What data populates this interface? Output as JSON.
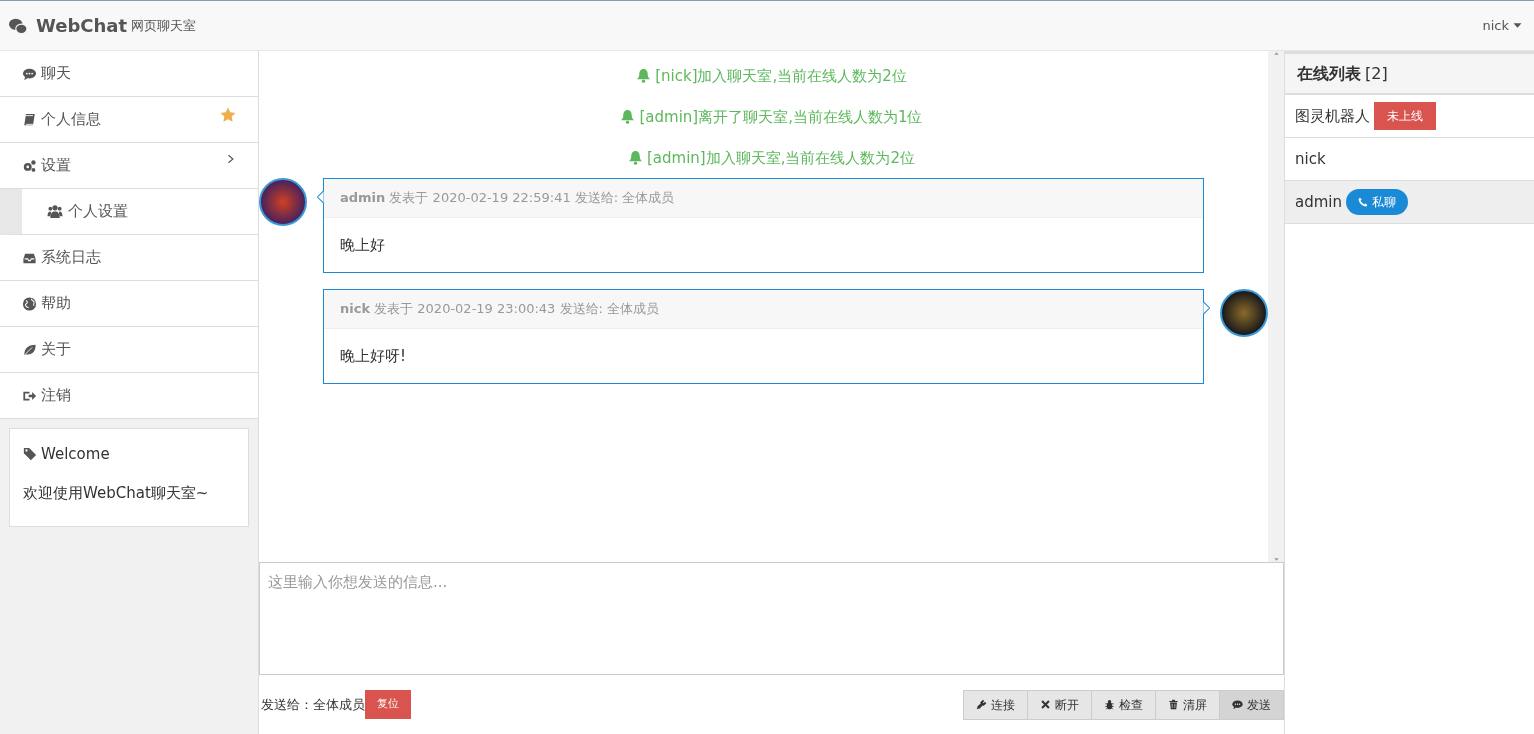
{
  "navbar": {
    "brand": "WebChat",
    "subtitle": "网页聊天室",
    "user": "nick"
  },
  "sidebar": {
    "items": [
      {
        "label": "聊天",
        "starred": false,
        "expanded": false
      },
      {
        "label": "个人信息",
        "starred": true,
        "expanded": false
      },
      {
        "label": "设置",
        "starred": false,
        "expanded": true,
        "children": [
          {
            "label": "个人设置"
          }
        ]
      },
      {
        "label": "系统日志",
        "starred": false,
        "expanded": false
      },
      {
        "label": "帮助",
        "starred": false,
        "expanded": false
      },
      {
        "label": "关于",
        "starred": false,
        "expanded": false
      },
      {
        "label": "注销",
        "starred": false,
        "expanded": false
      }
    ],
    "welcome": {
      "title": "Welcome",
      "text": "欢迎使用WebChat聊天室~"
    }
  },
  "chat": {
    "notices": [
      "[nick]加入聊天室,当前在线人数为2位",
      "[admin]离开了聊天室,当前在线人数为1位",
      "[admin]加入聊天室,当前在线人数为2位"
    ],
    "messages": [
      {
        "kind": "incoming",
        "user": "admin",
        "meta": "发表于 2020-02-19 22:59:41 发送给: 全体成员",
        "text": "晚上好"
      },
      {
        "kind": "outgoing",
        "user": "nick",
        "meta": "发表于 2020-02-19 23:00:43 发送给: 全体成员",
        "text": "晚上好呀!"
      }
    ],
    "input": {
      "placeholder": "这里输入你想发送的信息..."
    },
    "send_to": "发送给：全体成员",
    "reset_button": "复位",
    "buttons": [
      {
        "label": "连接",
        "selected": false
      },
      {
        "label": "断开",
        "selected": false
      },
      {
        "label": "检查",
        "selected": false
      },
      {
        "label": "清屏",
        "selected": false
      },
      {
        "label": "发送",
        "selected": true
      }
    ]
  },
  "online": {
    "title": "在线列表",
    "count": "[2]",
    "users": [
      {
        "name": "图灵机器人",
        "selected": false,
        "badge": {
          "kind": "offline",
          "label": "未上线"
        }
      },
      {
        "name": "nick",
        "selected": false
      },
      {
        "name": "admin",
        "selected": true,
        "badge": {
          "kind": "private",
          "label": "私聊"
        }
      }
    ]
  }
}
